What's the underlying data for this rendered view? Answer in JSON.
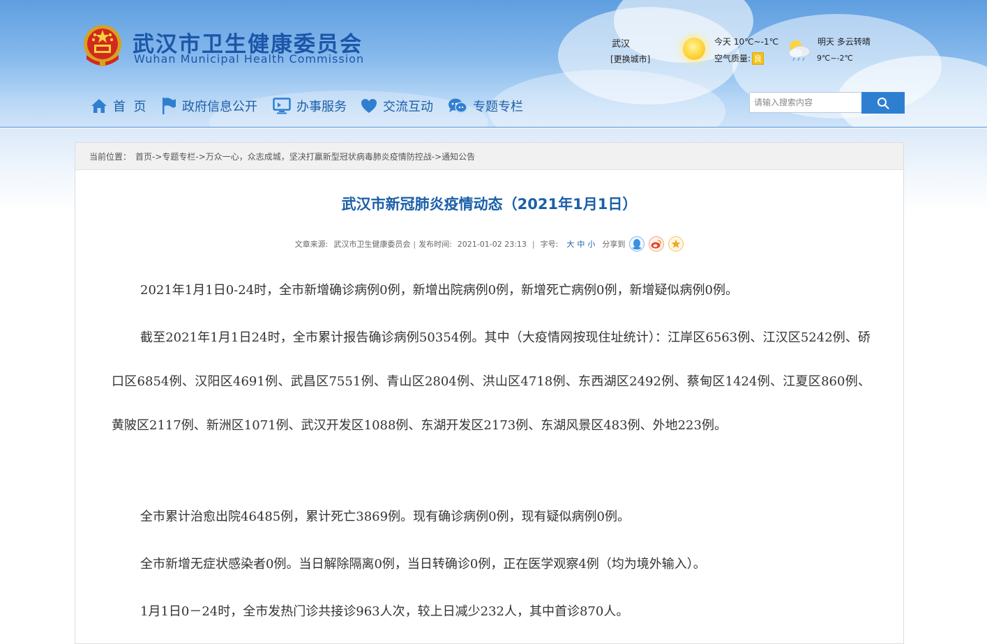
{
  "site": {
    "title": "武汉市卫生健康委员会",
    "subtitle": "Wuhan Municipal Health Commission"
  },
  "weather": {
    "city": "武汉",
    "change_city": "[更换城市]",
    "today": "今天  10℃~-1℃",
    "air_quality_label": "空气质量:",
    "air_quality_value": "良",
    "tomorrow": "明天  多云转晴",
    "tomorrow_temp": "9℃~-2℃",
    "icons": [
      "sun-icon",
      "cloudy-sun-icon"
    ]
  },
  "nav": {
    "items": [
      {
        "label": "首  页",
        "icon": "home-icon"
      },
      {
        "label": "政府信息公开",
        "icon": "flag-icon"
      },
      {
        "label": "办事服务",
        "icon": "monitor-icon"
      },
      {
        "label": "交流互动",
        "icon": "heart-icon"
      },
      {
        "label": "专题专栏",
        "icon": "chat-icon"
      }
    ]
  },
  "search": {
    "placeholder": "请输入搜索内容",
    "icon": "search-icon"
  },
  "breadcrumb": {
    "label": "当前位置：",
    "path": "首页->专题专栏->万众一心，众志成城，坚决打赢新型冠状病毒肺炎疫情防控战->通知公告"
  },
  "article": {
    "title": "武汉市新冠肺炎疫情动态（2021年1月1日）",
    "meta": {
      "source_label": "文章来源:",
      "source": "武汉市卫生健康委员会",
      "time_label": "发布时间:",
      "time": "2021-01-02 23:13",
      "font_label": "字号:",
      "font_sizes": [
        "大",
        "中",
        "小"
      ],
      "share_label": "分享到"
    },
    "paragraphs": [
      "2021年1月1日0-24时，全市新增确诊病例0例，新增出院病例0例，新增死亡病例0例，新增疑似病例0例。",
      "截至2021年1月1日24时，全市累计报告确诊病例50354例。其中（大疫情网按现住址统计）：江岸区6563例、江汉区5242例、硚口区6854例、汉阳区4691例、武昌区7551例、青山区2804例、洪山区4718例、东西湖区2492例、蔡甸区1424例、江夏区860例、黄陂区2117例、新洲区1071例、武汉开发区1088例、东湖开发区2173例、东湖风景区483例、外地223例。",
      "全市累计治愈出院46485例，累计死亡3869例。现有确诊病例0例，现有疑似病例0例。",
      "全市新增无症状感染者0例。当日解除隔离0例，当日转确诊0例，正在医学观察4例（均为境外输入）。",
      "1月1日0－24时，全市发热门诊共接诊963人次，较上日减少232人，其中首诊870人。"
    ]
  },
  "colors": {
    "brand_blue": "#1c56a8",
    "title_blue": "#1a5fa8",
    "search_button": "#2f7fd1",
    "air_quality_badge": "#f4c21b"
  }
}
